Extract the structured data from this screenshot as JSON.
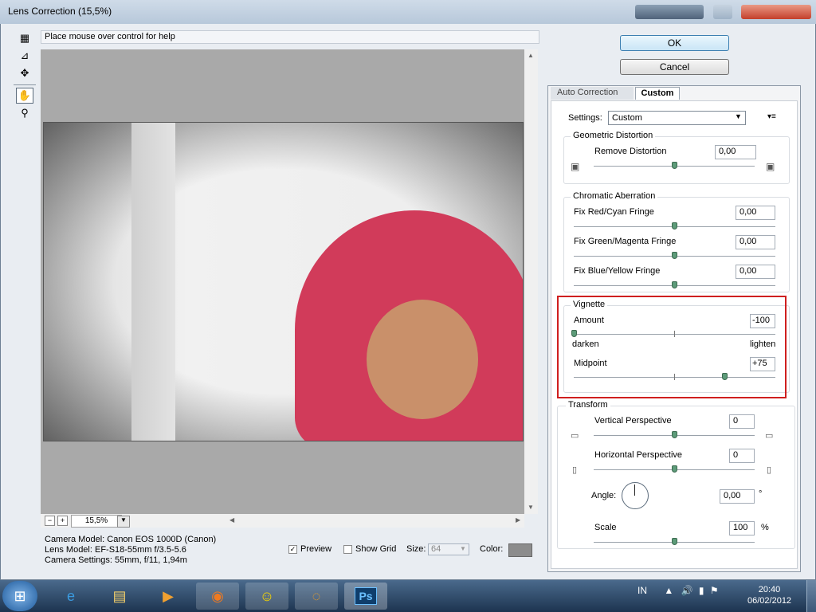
{
  "window": {
    "title": "Lens Correction (15,5%)"
  },
  "help_text": "Place mouse over control for help",
  "tools": [
    "remove-distortion-tool-icon",
    "straighten-tool-icon",
    "move-grid-tool-icon",
    "hand-tool-icon",
    "zoom-tool-icon"
  ],
  "zoom": {
    "minus": "−",
    "plus": "+",
    "value": "15,5%"
  },
  "camera_info": {
    "model": "Camera Model: Canon EOS 1000D (Canon)",
    "lens": "Lens Model: EF-S18-55mm f/3.5-5.6",
    "settings": "Camera Settings: 55mm, f/11, 1,94m"
  },
  "preview_options": {
    "preview_label": "Preview",
    "preview_checked": true,
    "grid_label": "Show Grid",
    "grid_checked": false,
    "size_label": "Size:",
    "size_value": "64",
    "color_label": "Color:"
  },
  "buttons": {
    "ok": "OK",
    "cancel": "Cancel"
  },
  "tabs": {
    "auto": "Auto Correction",
    "custom": "Custom"
  },
  "settings": {
    "label": "Settings:",
    "value": "Custom"
  },
  "geometric": {
    "title": "Geometric Distortion",
    "remove_label": "Remove Distortion",
    "remove_value": "0,00"
  },
  "chromatic": {
    "title": "Chromatic Aberration",
    "red_label": "Fix Red/Cyan Fringe",
    "red_value": "0,00",
    "green_label": "Fix Green/Magenta Fringe",
    "green_value": "0,00",
    "blue_label": "Fix Blue/Yellow Fringe",
    "blue_value": "0,00"
  },
  "vignette": {
    "title": "Vignette",
    "amount_label": "Amount",
    "amount_value": "-100",
    "darken": "darken",
    "lighten": "lighten",
    "midpoint_label": "Midpoint",
    "midpoint_value": "+75"
  },
  "transform": {
    "title": "Transform",
    "vertical_label": "Vertical Perspective",
    "vertical_value": "0",
    "horizontal_label": "Horizontal Perspective",
    "horizontal_value": "0",
    "angle_label": "Angle:",
    "angle_value": "0,00",
    "angle_unit": "°",
    "scale_label": "Scale",
    "scale_value": "100",
    "scale_unit": "%"
  },
  "taskbar": {
    "apps": [
      "internet-explorer-icon",
      "windows-explorer-icon",
      "media-player-icon",
      "firefox-icon",
      "yahoo-messenger-icon",
      "app-icon",
      "photoshop-icon"
    ],
    "photoshop_label": "Ps",
    "language": "IN",
    "time": "20:40",
    "date": "06/02/2012"
  },
  "colors": {
    "accent_highlight": "#cf1f1f",
    "slider_thumb": "#5d9b79",
    "preview_bg": "#a9a9a9"
  }
}
